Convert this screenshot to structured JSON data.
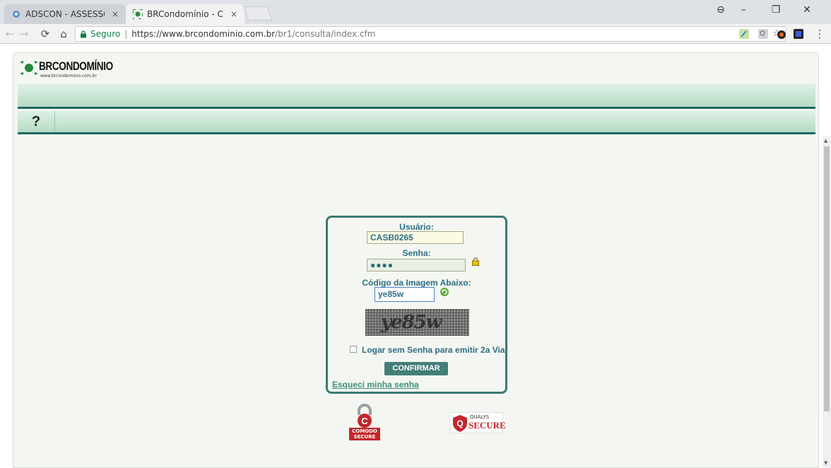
{
  "browser": {
    "tabs": [
      {
        "title": "ADSCON - ASSESSORIA",
        "close": "×"
      },
      {
        "title": "BRCondomínio - Consult",
        "close": "×"
      }
    ],
    "window_controls": [
      "⊖",
      "–",
      "❐",
      "✕"
    ],
    "address": {
      "secure_label": "Seguro",
      "url_host": "https://www.brcondominio.com.br",
      "url_path": "/br1/consulta/index.cfm"
    }
  },
  "site": {
    "logo_text": "BRCONDOMÍNIO",
    "logo_sub": "www.brcondominio.com.br",
    "help_label": "?"
  },
  "login": {
    "user_label": "Usuário:",
    "user_value": "CASB0265",
    "password_label": "Senha:",
    "password_value": "●●●●",
    "code_label": "Código da Imagem Abaixo:",
    "code_value": "ye85w",
    "captcha_text": "ye85w",
    "checkbox_label": "Logar sem Senha para emitir 2a Via",
    "confirm_label": "CONFIRMAR",
    "forgot_label": "Esqueci minha senha"
  },
  "badges": {
    "comodo_line1": "COMODO",
    "comodo_line2": "SECURE",
    "qualys_line1": "QUALYS",
    "qualys_line2": "SECURE"
  },
  "colors": {
    "teal": "#1b6a60",
    "label_blue": "#2d6e86",
    "button": "#437e78"
  }
}
